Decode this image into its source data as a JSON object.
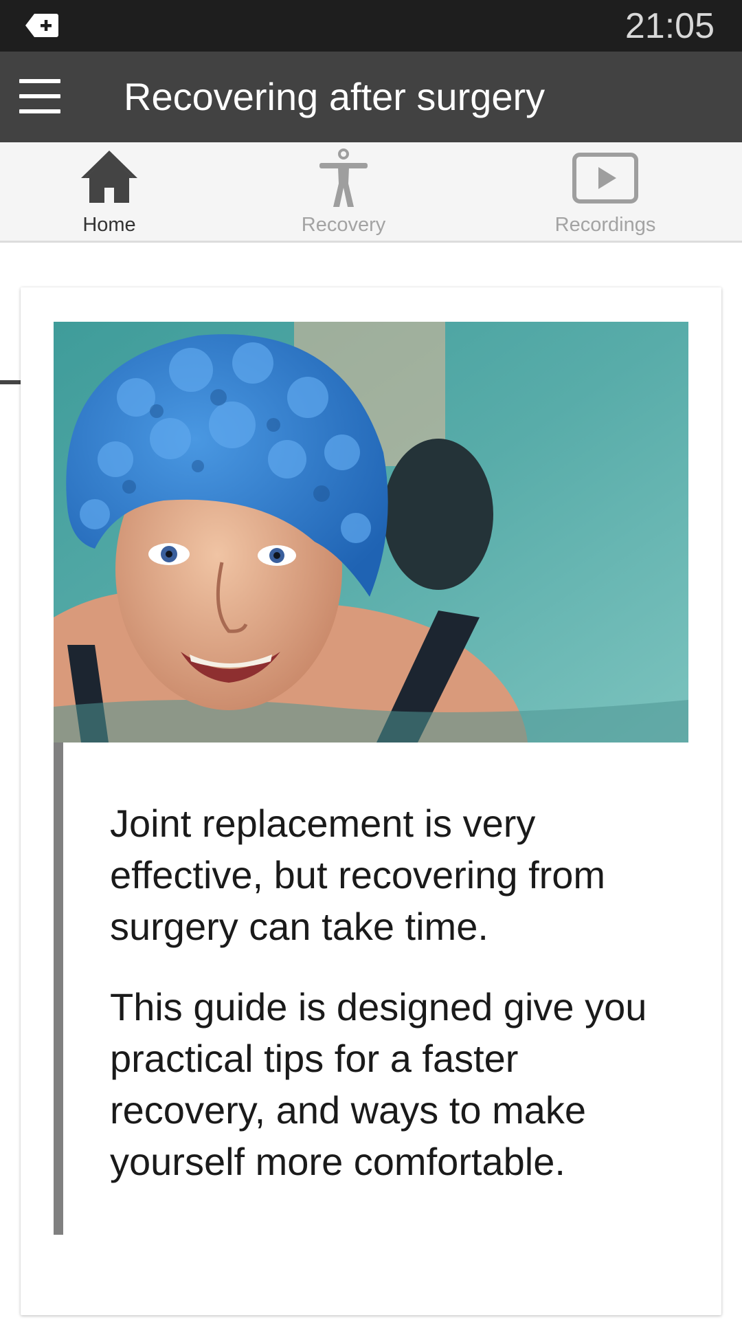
{
  "status_bar": {
    "time": "21:05",
    "notification_icon": "plus-tag-icon"
  },
  "app_bar": {
    "menu_icon": "hamburger-menu-icon",
    "title": "Recovering after surgery"
  },
  "tabs": [
    {
      "label": "Home",
      "icon": "home-icon",
      "selected": true
    },
    {
      "label": "Recovery",
      "icon": "person-figure-icon",
      "selected": false
    },
    {
      "label": "Recordings",
      "icon": "play-button-icon",
      "selected": false
    }
  ],
  "card": {
    "image_description": "hero-photo-swimmer",
    "paragraphs": [
      "Joint replacement is very effective, but recovering from surgery can take time.",
      "This guide is designed give you practical tips for a faster recovery, and ways to make yourself more comfortable."
    ]
  },
  "colors": {
    "status_bar": "#1e1e1e",
    "app_bar": "#424242",
    "tab_bar": "#f5f5f5",
    "tab_active": "#333333",
    "tab_inactive": "#a3a3a3",
    "quote_bar": "#808080",
    "swim_cap": "#2f7fd0",
    "pool_water": "#4fa3a0"
  }
}
